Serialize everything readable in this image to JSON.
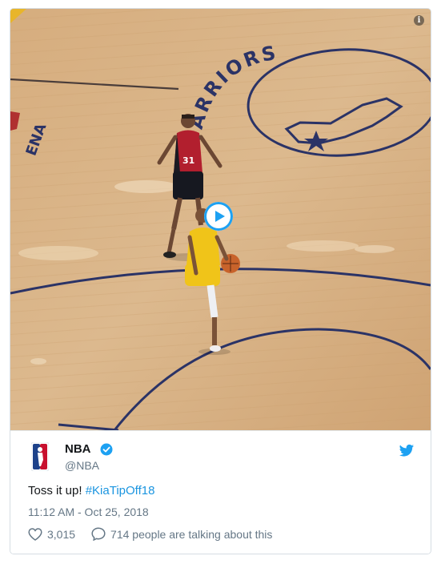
{
  "tweet": {
    "display_name": "NBA",
    "handle": "@NBA",
    "text": "Toss it up! ",
    "hashtag": "#KiaTipOff18",
    "timestamp": "11:12 AM - Oct 25, 2018",
    "likes": "3,015",
    "conversation": "714 people are talking about this"
  },
  "media": {
    "court_text": "WARRIORS",
    "court_left_text": "ENA",
    "jersey_number": "31",
    "info_glyph": "i"
  },
  "colors": {
    "hashtag": "#1b95e0",
    "verified": "#1da1f2",
    "twitter": "#1da1f2",
    "court_navy": "#2b3366",
    "court_wood": "#d9b488"
  },
  "icons": [
    "info-icon",
    "play-icon",
    "nba-logo",
    "verified-icon",
    "twitter-bird-icon",
    "heart-icon",
    "reply-bubble-icon"
  ]
}
